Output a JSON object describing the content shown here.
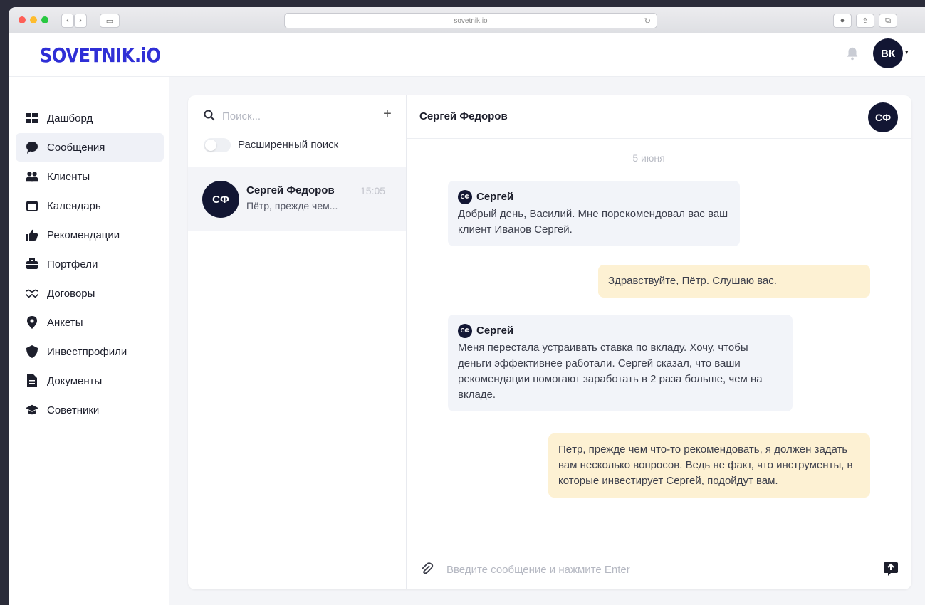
{
  "browser": {
    "url": "sovetnik.io"
  },
  "app": {
    "logo": "SOVETNIK.iO",
    "user_initials": "ВК"
  },
  "sidebar": {
    "items": [
      {
        "label": "Дашборд",
        "icon": "dashboard-icon"
      },
      {
        "label": "Сообщения",
        "icon": "chat-bubble-icon",
        "active": true
      },
      {
        "label": "Клиенты",
        "icon": "users-icon"
      },
      {
        "label": "Календарь",
        "icon": "calendar-icon"
      },
      {
        "label": "Рекомендации",
        "icon": "thumbs-up-icon"
      },
      {
        "label": "Портфели",
        "icon": "briefcase-icon"
      },
      {
        "label": "Договоры",
        "icon": "handshake-icon"
      },
      {
        "label": "Анкеты",
        "icon": "location-pin-icon"
      },
      {
        "label": "Инвестпрофили",
        "icon": "shield-icon"
      },
      {
        "label": "Документы",
        "icon": "document-icon"
      },
      {
        "label": "Советники",
        "icon": "graduation-cap-icon"
      }
    ]
  },
  "conversations": {
    "search_placeholder": "Поиск...",
    "advanced_search_label": "Расширенный поиск",
    "items": [
      {
        "initials": "СФ",
        "name": "Сергей Федоров",
        "time": "15:05",
        "preview": "Пётр, прежде чем..."
      }
    ]
  },
  "chat": {
    "title": "Сергей Федоров",
    "initials": "СФ",
    "date": "5 июня",
    "messages": [
      {
        "direction": "in",
        "sender": "Сергей",
        "initials": "СФ",
        "text": "Добрый день, Василий. Мне порекомендовал вас ваш клиент Иванов Сергей."
      },
      {
        "direction": "out",
        "text": "Здравствуйте, Пётр. Слушаю вас."
      },
      {
        "direction": "in",
        "sender": "Сергей",
        "initials": "СФ",
        "text": "Меня перестала устраивать ставка по вкладу. Хочу, чтобы деньги эффективнее работали. Сергей сказал, что ваши рекомендации помогают заработать в 2 раза больше, чем на вкладе."
      },
      {
        "direction": "out",
        "text": "Пётр, прежде чем что-то рекомендовать, я должен задать вам несколько вопросов. Ведь не факт, что инструменты, в которые инвестирует Сергей, подойдут вам."
      }
    ],
    "input_placeholder": "Введите сообщение и нажмите Enter"
  }
}
